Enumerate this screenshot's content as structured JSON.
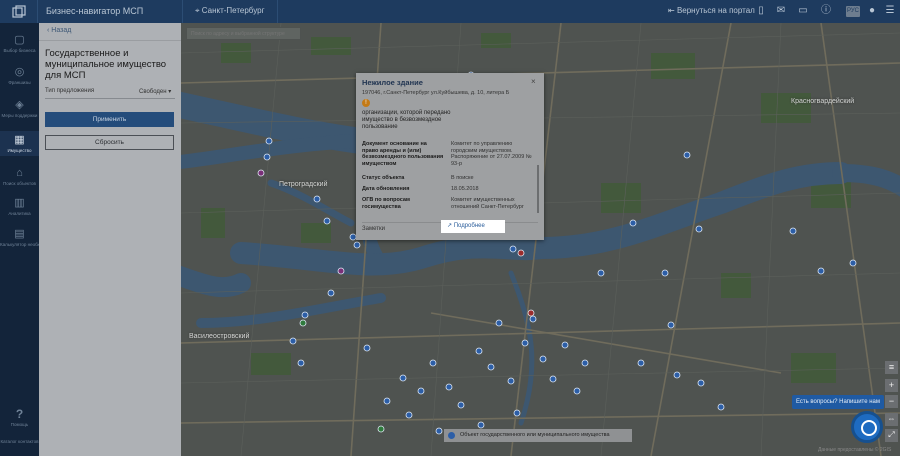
{
  "header": {
    "app_title": "Бизнес-навигатор МСП",
    "city": "Санкт-Петербург",
    "return_label": "Вернуться на портал",
    "lang": "РУС"
  },
  "sidebar": {
    "items": [
      {
        "label": "Выбор бизнеса",
        "icon": "bag-icon"
      },
      {
        "label": "Франшизы",
        "icon": "franchise-icon"
      },
      {
        "label": "Меры поддержки",
        "icon": "support-icon"
      },
      {
        "label": "Имущество",
        "icon": "property-icon"
      },
      {
        "label": "Поиск объектов",
        "icon": "objects-icon"
      },
      {
        "label": "Аналитика",
        "icon": "analytics-icon"
      },
      {
        "label": "Калькулятор необходимых затрат",
        "icon": "calculator-icon"
      },
      {
        "label": "Помощь",
        "icon": "help-icon"
      },
      {
        "label": "Каталог контактов",
        "icon": "contacts-icon"
      }
    ]
  },
  "panel": {
    "back_label": "Назад",
    "title": "Государственное и муниципальное имущество для МСП",
    "select_label": "Тип предложения",
    "select_value": "Свободен",
    "apply_label": "Применить",
    "reset_label": "Сбросить"
  },
  "map": {
    "search_placeholder": "Поиск по адресу и выбранной структуре",
    "city_labels": {
      "petrogradsky": "Петроградский",
      "vasileostrovsky": "Василеостровский",
      "krasnogvardeysky": "Красногвардейский"
    },
    "popup": {
      "title": "Нежилое здание",
      "address": "197046, г.Санкт-Петербург ул.Куйбышева, д. 10, литера Б",
      "description": "организации, которой передано имущество в безвозмездное пользование",
      "rows": [
        {
          "key": "Документ основание на право аренды и (или) безвозмездного пользования имуществом",
          "value": "Комитет по управлению городским имуществом. Распоряжение от 27.07.2009 № 93-р"
        },
        {
          "key": "Статус объекта",
          "value": "В поиске"
        },
        {
          "key": "Дата обновления",
          "value": "18.05.2018"
        },
        {
          "key": "ОГВ по вопросам госимущества",
          "value": "Комитет имущественных отношений Санкт-Петербург"
        }
      ],
      "notes_label": "Заметки",
      "more_label": "Подробнее",
      "close_label": "×"
    },
    "legend_text": "Объект государственного или муниципального имущества",
    "questions_label": "Есть вопросы? Напишите нам",
    "copyright": "Данные предоставлены © 2GIS"
  },
  "colors": {
    "header": "#1e3b5f",
    "rail": "#13243a",
    "accent": "#244c7b",
    "marker": "#2c5ea7"
  }
}
